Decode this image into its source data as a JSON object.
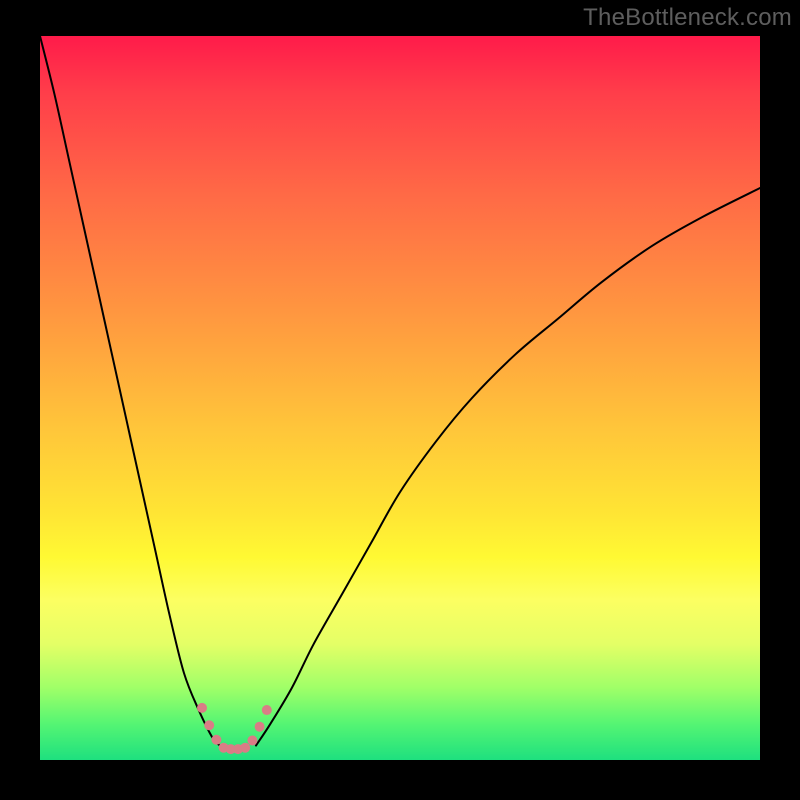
{
  "watermark": "TheBottleneck.com",
  "chart_data": {
    "type": "line",
    "title": "",
    "xlabel": "",
    "ylabel": "",
    "xlim": [
      0,
      100
    ],
    "ylim": [
      0,
      100
    ],
    "grid": false,
    "legend": false,
    "gradient_stops": [
      {
        "pct": 0,
        "color": "#ff1b4a"
      },
      {
        "pct": 8,
        "color": "#ff3e4a"
      },
      {
        "pct": 22,
        "color": "#ff6a46"
      },
      {
        "pct": 38,
        "color": "#ff9640"
      },
      {
        "pct": 54,
        "color": "#ffc53a"
      },
      {
        "pct": 66,
        "color": "#ffe534"
      },
      {
        "pct": 72,
        "color": "#fff933"
      },
      {
        "pct": 78,
        "color": "#fcff62"
      },
      {
        "pct": 84,
        "color": "#e4ff66"
      },
      {
        "pct": 90,
        "color": "#a0ff68"
      },
      {
        "pct": 95,
        "color": "#55f573"
      },
      {
        "pct": 100,
        "color": "#1ee07f"
      }
    ],
    "series": [
      {
        "name": "black-curve-left",
        "color": "#000000",
        "stroke_width": 2,
        "x": [
          0,
          2,
          4,
          6,
          8,
          10,
          12,
          14,
          16,
          18,
          20,
          22,
          24,
          25
        ],
        "y": [
          100,
          92,
          83,
          74,
          65,
          56,
          47,
          38,
          29,
          20,
          12,
          7,
          3,
          2
        ]
      },
      {
        "name": "black-curve-right",
        "color": "#000000",
        "stroke_width": 2,
        "x": [
          30,
          32,
          35,
          38,
          42,
          46,
          50,
          55,
          60,
          66,
          72,
          78,
          85,
          92,
          100
        ],
        "y": [
          2,
          5,
          10,
          16,
          23,
          30,
          37,
          44,
          50,
          56,
          61,
          66,
          71,
          75,
          79
        ]
      },
      {
        "name": "pink-valley",
        "color": "#d97d86",
        "stroke_width": 10,
        "x": [
          22.5,
          23.5,
          24.5,
          25.5,
          26.5,
          27.5,
          28.5,
          29.5,
          30.5,
          31.5
        ],
        "y": [
          7.2,
          4.8,
          2.8,
          1.7,
          1.5,
          1.5,
          1.7,
          2.7,
          4.6,
          6.9
        ]
      }
    ]
  }
}
